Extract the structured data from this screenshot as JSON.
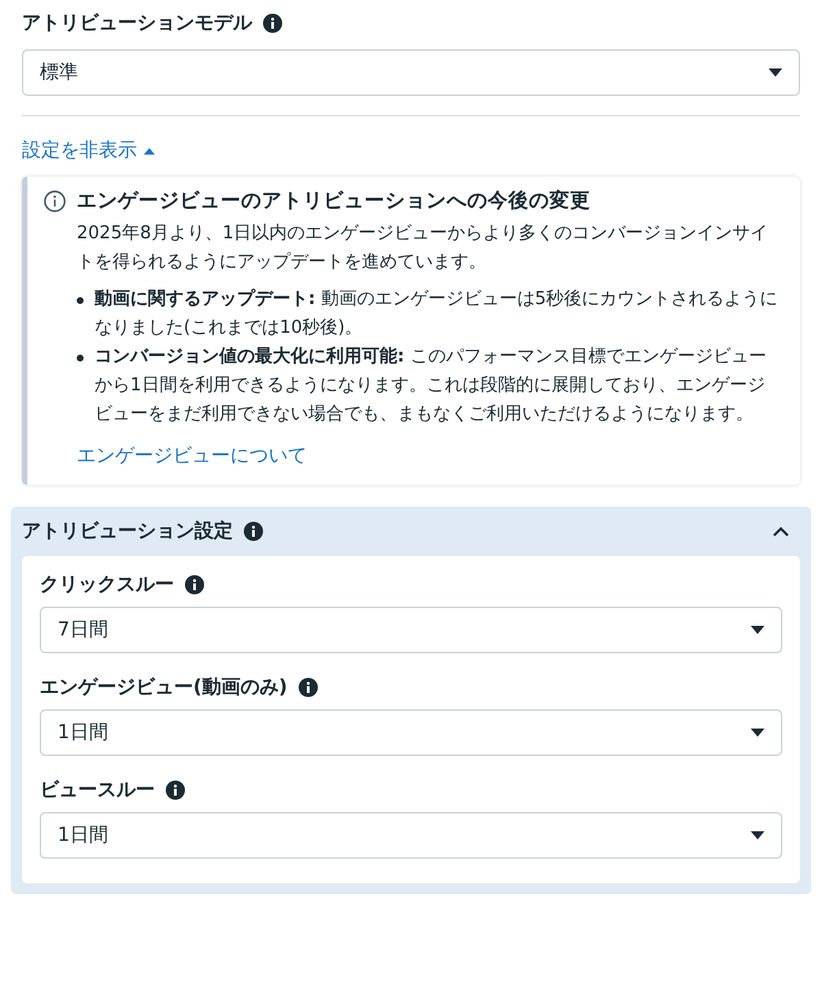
{
  "attribution_model": {
    "label": "アトリビューションモデル",
    "value": "標準"
  },
  "settings_toggle": {
    "label": "設定を非表示",
    "expanded": true
  },
  "notice": {
    "title": "エンゲージビューのアトリビューションへの今後の変更",
    "body": "2025年8月より、1日以内のエンゲージビューからより多くのコンバージョンインサイトを得られるようにアップデートを進めています。",
    "bullets": [
      {
        "text": "**動画に関するアップデート:** 動画のエンゲージビューは5秒後にカウントされるようになりました(これまでは10秒後)。"
      },
      {
        "text": "**コンバージョン値の最大化に利用可能:** このパフォーマンス目標でエンゲージビューから1日間を利用できるようになります。これは段階的に展開しており、エンゲージビューをまだ利用できない場合でも、まもなくご利用いただけるようになります。"
      }
    ],
    "link": "エンゲージビューについて"
  },
  "attribution_settings": {
    "title": "アトリビューション設定",
    "expanded": true,
    "fields": [
      {
        "label": "クリックスルー",
        "value": "7日間"
      },
      {
        "label": "エンゲージビュー(動画のみ)",
        "value": "1日間"
      },
      {
        "label": "ビュースルー",
        "value": "1日間"
      }
    ]
  }
}
